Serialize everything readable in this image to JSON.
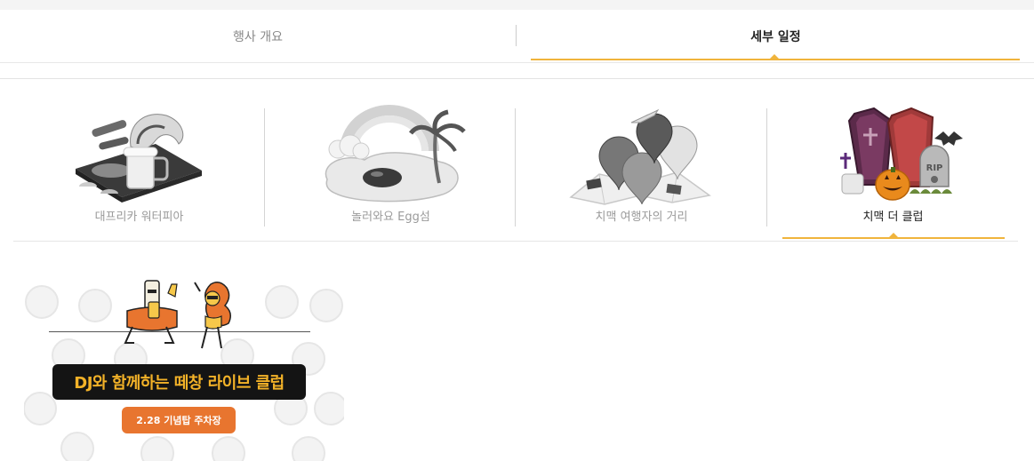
{
  "main_tabs": [
    {
      "label": "행사 개요",
      "active": false
    },
    {
      "label": "세부 일정",
      "active": true
    }
  ],
  "zones": [
    {
      "label": "대프리카 워터피아",
      "icon": "waterpark-icon",
      "active": false
    },
    {
      "label": "놀러와요 Egg섬",
      "icon": "egg-island-icon",
      "active": false
    },
    {
      "label": "치맥 여행자의 거리",
      "icon": "mbti-map-icon",
      "active": false
    },
    {
      "label": "치맥 더 클럽",
      "icon": "halloween-club-icon",
      "active": true
    }
  ],
  "event_card": {
    "title": "DJ와 함께하는 떼창 라이브 클럽",
    "badge": "2.28 기념탑 주차장",
    "illustration": "chicken-beer-mascots-icon"
  },
  "colors": {
    "accent": "#f0b43c",
    "active_text": "#222222",
    "inactive_text": "#9a9a9a",
    "card_title_bg": "#141414",
    "card_title_text": "#f3b228",
    "badge_bg": "#e8752f"
  }
}
